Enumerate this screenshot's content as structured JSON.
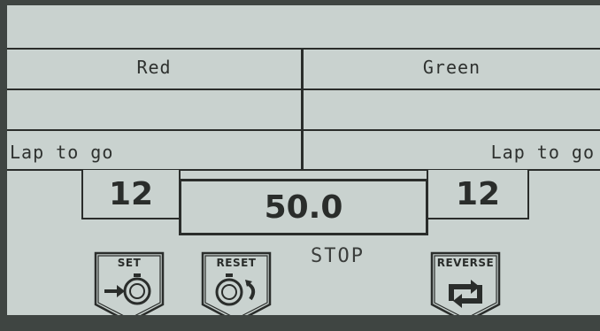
{
  "lanes": {
    "left": {
      "name": "Red",
      "laps_label": "Lap to go",
      "laps_value": "12"
    },
    "right": {
      "name": "Green",
      "laps_label": "Lap to go",
      "laps_value": "12"
    }
  },
  "timer": {
    "value": "50.0",
    "status": "STOP"
  },
  "buttons": {
    "set": {
      "label": "SET",
      "icon": "stopwatch-set-icon"
    },
    "reset": {
      "label": "RESET",
      "icon": "stopwatch-reset-icon"
    },
    "reverse": {
      "label": "REVERSE",
      "icon": "reverse-arrows-icon"
    }
  },
  "colors": {
    "screen": "#c9d2cf",
    "ink": "#2a2d2b",
    "bezel": "#3f4542"
  }
}
